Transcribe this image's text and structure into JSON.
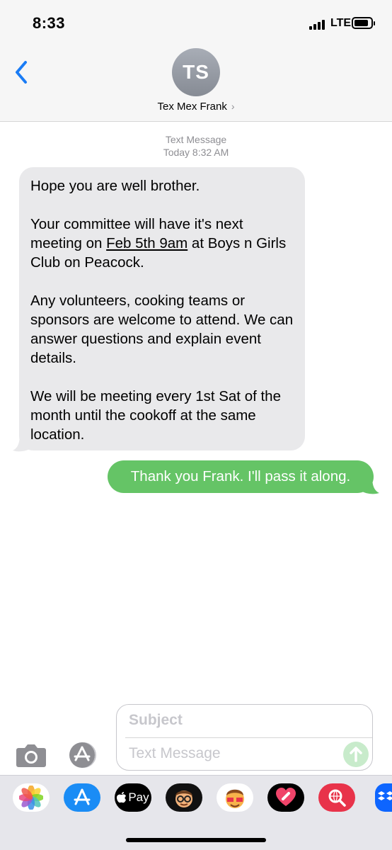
{
  "status_bar": {
    "time": "8:33",
    "network": "LTE",
    "battery_level": 0.85
  },
  "header": {
    "back_icon": "chevron-left-icon",
    "avatar_initials": "TS",
    "contact_name": "Tex Mex Frank",
    "contact_chevron": "›"
  },
  "conversation": {
    "service_label": "Text Message",
    "timestamp": "Today 8:32 AM",
    "incoming": {
      "p1": "Hope you are well brother.",
      "p2_before": "Your committee will have it's next meeting on ",
      "p2_link": "Feb 5th 9am",
      "p2_after": " at Boys n Girls Club on Peacock.",
      "p3": "Any volunteers, cooking teams or sponsors are welcome to attend. We can answer questions and explain event details.",
      "p4": "We will be meeting every 1st Sat of the month until the cookoff at the same location."
    },
    "outgoing": "Thank you Frank. I'll pass it along."
  },
  "compose": {
    "subject_placeholder": "Subject",
    "message_placeholder": "Text Message"
  },
  "app_drawer": {
    "apps": [
      "photos-icon",
      "app-store-icon",
      "apple-pay-icon",
      "memoji-icon",
      "animoji-icon",
      "digital-touch-icon",
      "web-search-icon",
      "dropbox-icon"
    ],
    "apple_pay_label": "Pay"
  },
  "colors": {
    "accent": "#1a7cf5",
    "incoming_bubble": "#e9e9eb",
    "outgoing_bubble": "#65c466",
    "placeholder": "#c7c7cc"
  }
}
